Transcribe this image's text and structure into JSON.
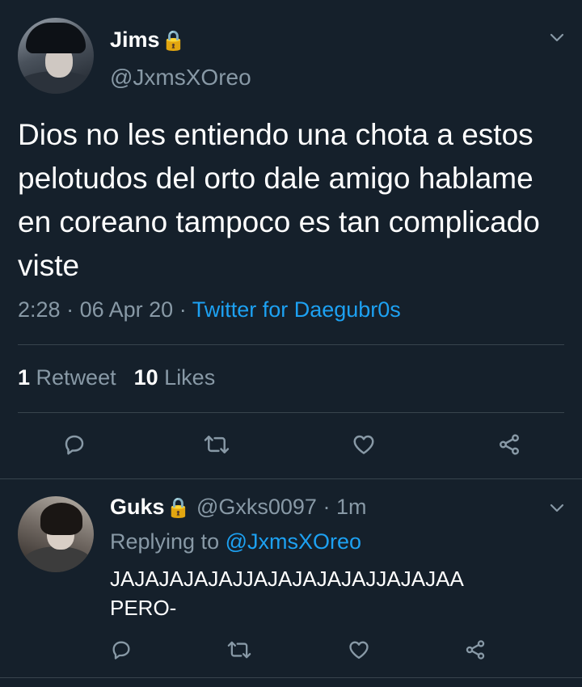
{
  "main_tweet": {
    "name": "Jims",
    "lock_glyph": "🔒",
    "handle": "@JxmsXOreo",
    "text": "Dios no les entiendo una chota a estos pelotudos del orto dale amigo hablame en coreano tampoco es tan complicado viste",
    "time": "2:28",
    "date": "06 Apr 20",
    "client": "Twitter for Daegubr0s",
    "retweet_count": "1",
    "retweet_label": "Retweet",
    "like_count": "10",
    "like_label": "Likes"
  },
  "reply_tweet": {
    "name": "Guks",
    "lock_glyph": "🔒",
    "handle": "@Gxks0097",
    "age": "1m",
    "replying_label": "Replying to",
    "replying_to": "@JxmsXOreo",
    "text_line1": "JAJAJAJAJAJJAJAJAJAJAJJAJAJAA",
    "text_line2": "PERO-"
  },
  "icons": {
    "reply": "reply-icon",
    "retweet": "retweet-icon",
    "like": "heart-icon",
    "share": "share-icon",
    "menu": "chevron-down-icon"
  },
  "colors": {
    "background": "#15202b",
    "text": "#ffffff",
    "secondary": "#8899a6",
    "accent": "#1da1f2",
    "divider": "#38444d"
  }
}
